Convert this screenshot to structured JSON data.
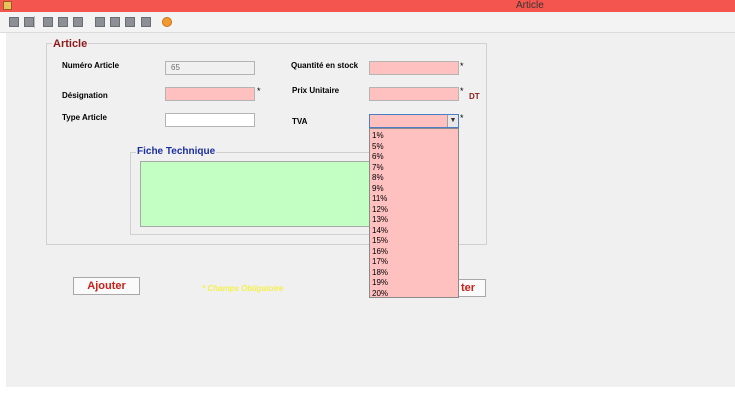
{
  "window": {
    "title": "Article"
  },
  "toolbar": {
    "icons": [
      "add-icon",
      "save-icon",
      "edit-icon",
      "delete-icon",
      "first-icon",
      "prev-icon",
      "next-icon",
      "last-icon",
      "refresh-icon",
      "exit-icon"
    ]
  },
  "form": {
    "group_title": "Article",
    "numero_label": "Numéro Article",
    "numero_value": "65",
    "designation_label": "Désignation",
    "designation_value": "",
    "type_label": "Type Article",
    "type_value": "",
    "quantite_label": "Quantité en stock",
    "quantite_value": "",
    "prix_label": "Prix Unitaire",
    "prix_value": "",
    "currency": "DT",
    "tva_label": "TVA",
    "tva_value": "",
    "tva_options": [
      "1%",
      "5%",
      "6%",
      "7%",
      "8%",
      "9%",
      "11%",
      "12%",
      "13%",
      "14%",
      "15%",
      "16%",
      "17%",
      "18%",
      "19%",
      "20%"
    ],
    "required_mark": "*",
    "fiche_title": "Fiche Technique",
    "fiche_value": ""
  },
  "actions": {
    "ajouter_label": "Ajouter",
    "second_label_visible": "ter",
    "required_note": "* Champs Obligatoire"
  },
  "colors": {
    "titlebar": "#f5554f",
    "required_field": "#ffc0c0",
    "fiche_bg": "#c3ffc3",
    "button_text": "#c8201a",
    "note_text": "#f4f04c"
  }
}
